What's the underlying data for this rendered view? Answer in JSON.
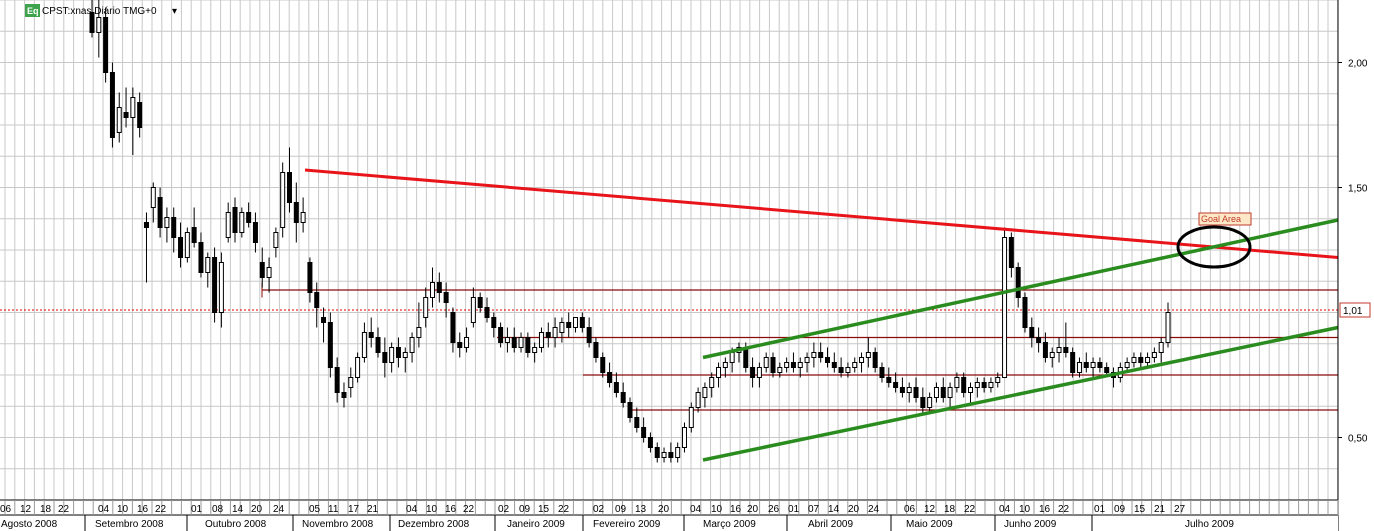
{
  "header": {
    "badge": "Eq",
    "title": "CPST:xnas Diário TMG+0",
    "menu_arrow": "▾"
  },
  "chart_data": {
    "type": "candlestick",
    "symbol": "CPST:xnas",
    "period": "Diário",
    "ylim": [
      0.25,
      2.25
    ],
    "yticks": [
      "2,00",
      "1,50",
      "1,01",
      "0,50"
    ],
    "ytick_values": [
      2.0,
      1.5,
      1.01,
      0.5
    ],
    "last_price_label": "1,01",
    "last_price": 1.01,
    "x_day_labels": [
      "06",
      "12",
      "18",
      "22",
      "04",
      "10",
      "16",
      "22",
      "01",
      "08",
      "14",
      "20",
      "24",
      "05",
      "11",
      "17",
      "21",
      "04",
      "10",
      "16",
      "22",
      "02",
      "09",
      "15",
      "22",
      "02",
      "09",
      "13",
      "20",
      "04",
      "10",
      "16",
      "20",
      "26",
      "01",
      "07",
      "14",
      "20",
      "24",
      "06",
      "12",
      "18",
      "22",
      "04",
      "10",
      "16",
      "22",
      "01",
      "09",
      "15",
      "21",
      "27"
    ],
    "x_months": [
      "Agosto 2008",
      "Setembro 2008",
      "Outubro 2008",
      "Novembro 2008",
      "Dezembro 2008",
      "Janeiro 2009",
      "Fevereiro 2009",
      "Março 2009",
      "Abril 2009",
      "Maio 2009",
      "Junho 2009",
      "Julho 2009"
    ],
    "annotation": "Goal Area",
    "colors": {
      "resistance": "#e8141a",
      "channel": "#2a8c1e",
      "level_lines": "#8b0a0a",
      "last_price": "#e00000",
      "candle": "#000000",
      "grid": "#c8c8c8",
      "badge": "#3fa34d"
    },
    "candles": [
      {
        "o": 2.2,
        "h": 2.3,
        "l": 2.1,
        "c": 2.12
      },
      {
        "o": 2.12,
        "h": 2.25,
        "l": 2.02,
        "c": 2.18
      },
      {
        "o": 2.18,
        "h": 2.22,
        "l": 1.92,
        "c": 1.96
      },
      {
        "o": 1.96,
        "h": 2.0,
        "l": 1.66,
        "c": 1.7
      },
      {
        "o": 1.72,
        "h": 1.88,
        "l": 1.68,
        "c": 1.82
      },
      {
        "o": 1.8,
        "h": 1.9,
        "l": 1.74,
        "c": 1.78
      },
      {
        "o": 1.78,
        "h": 1.9,
        "l": 1.63,
        "c": 1.86
      },
      {
        "o": 1.84,
        "h": 1.88,
        "l": 1.7,
        "c": 1.74
      },
      {
        "o": 1.36,
        "h": 1.4,
        "l": 1.12,
        "c": 1.34
      },
      {
        "o": 1.42,
        "h": 1.52,
        "l": 1.36,
        "c": 1.5
      },
      {
        "o": 1.46,
        "h": 1.5,
        "l": 1.3,
        "c": 1.34
      },
      {
        "o": 1.34,
        "h": 1.42,
        "l": 1.28,
        "c": 1.38
      },
      {
        "o": 1.38,
        "h": 1.42,
        "l": 1.24,
        "c": 1.3
      },
      {
        "o": 1.3,
        "h": 1.36,
        "l": 1.18,
        "c": 1.22
      },
      {
        "o": 1.22,
        "h": 1.34,
        "l": 1.2,
        "c": 1.32
      },
      {
        "o": 1.34,
        "h": 1.42,
        "l": 1.26,
        "c": 1.28
      },
      {
        "o": 1.28,
        "h": 1.32,
        "l": 1.14,
        "c": 1.16
      },
      {
        "o": 1.16,
        "h": 1.24,
        "l": 1.1,
        "c": 1.22
      },
      {
        "o": 1.22,
        "h": 1.26,
        "l": 0.96,
        "c": 1.0
      },
      {
        "o": 1.0,
        "h": 1.24,
        "l": 0.94,
        "c": 1.2
      },
      {
        "o": 1.3,
        "h": 1.44,
        "l": 1.28,
        "c": 1.4
      },
      {
        "o": 1.42,
        "h": 1.46,
        "l": 1.28,
        "c": 1.32
      },
      {
        "o": 1.32,
        "h": 1.42,
        "l": 1.3,
        "c": 1.4
      },
      {
        "o": 1.4,
        "h": 1.44,
        "l": 1.34,
        "c": 1.36
      },
      {
        "o": 1.36,
        "h": 1.4,
        "l": 1.24,
        "c": 1.28
      },
      {
        "o": 1.2,
        "h": 1.26,
        "l": 1.1,
        "c": 1.14
      },
      {
        "o": 1.14,
        "h": 1.22,
        "l": 1.08,
        "c": 1.18
      },
      {
        "o": 1.26,
        "h": 1.34,
        "l": 1.22,
        "c": 1.32
      },
      {
        "o": 1.34,
        "h": 1.6,
        "l": 1.3,
        "c": 1.56
      },
      {
        "o": 1.56,
        "h": 1.66,
        "l": 1.4,
        "c": 1.44
      },
      {
        "o": 1.44,
        "h": 1.52,
        "l": 1.28,
        "c": 1.36
      },
      {
        "o": 1.36,
        "h": 1.46,
        "l": 1.32,
        "c": 1.4
      },
      {
        "o": 1.2,
        "h": 1.22,
        "l": 1.04,
        "c": 1.08
      },
      {
        "o": 1.08,
        "h": 1.12,
        "l": 0.94,
        "c": 1.02
      },
      {
        "o": 0.98,
        "h": 1.02,
        "l": 0.88,
        "c": 0.96
      },
      {
        "o": 0.96,
        "h": 1.0,
        "l": 0.74,
        "c": 0.78
      },
      {
        "o": 0.78,
        "h": 0.82,
        "l": 0.64,
        "c": 0.68
      },
      {
        "o": 0.68,
        "h": 0.72,
        "l": 0.62,
        "c": 0.66
      },
      {
        "o": 0.7,
        "h": 0.78,
        "l": 0.66,
        "c": 0.74
      },
      {
        "o": 0.74,
        "h": 0.84,
        "l": 0.72,
        "c": 0.82
      },
      {
        "o": 0.82,
        "h": 0.96,
        "l": 0.8,
        "c": 0.92
      },
      {
        "o": 0.92,
        "h": 0.98,
        "l": 0.86,
        "c": 0.9
      },
      {
        "o": 0.9,
        "h": 0.94,
        "l": 0.82,
        "c": 0.84
      },
      {
        "o": 0.84,
        "h": 0.9,
        "l": 0.74,
        "c": 0.8
      },
      {
        "o": 0.8,
        "h": 0.88,
        "l": 0.76,
        "c": 0.86
      },
      {
        "o": 0.86,
        "h": 0.9,
        "l": 0.78,
        "c": 0.82
      },
      {
        "o": 0.82,
        "h": 0.86,
        "l": 0.76,
        "c": 0.84
      },
      {
        "o": 0.84,
        "h": 0.92,
        "l": 0.8,
        "c": 0.9
      },
      {
        "o": 0.9,
        "h": 1.04,
        "l": 0.86,
        "c": 0.94
      },
      {
        "o": 0.98,
        "h": 1.1,
        "l": 0.94,
        "c": 1.06
      },
      {
        "o": 1.06,
        "h": 1.18,
        "l": 1.02,
        "c": 1.12
      },
      {
        "o": 1.12,
        "h": 1.16,
        "l": 1.04,
        "c": 1.08
      },
      {
        "o": 1.08,
        "h": 1.12,
        "l": 0.98,
        "c": 1.04
      },
      {
        "o": 1.0,
        "h": 1.02,
        "l": 0.84,
        "c": 0.88
      },
      {
        "o": 0.88,
        "h": 0.92,
        "l": 0.82,
        "c": 0.86
      },
      {
        "o": 0.86,
        "h": 0.94,
        "l": 0.84,
        "c": 0.9
      },
      {
        "o": 0.96,
        "h": 1.1,
        "l": 0.94,
        "c": 1.06
      },
      {
        "o": 1.06,
        "h": 1.08,
        "l": 1.0,
        "c": 1.02
      },
      {
        "o": 1.02,
        "h": 1.06,
        "l": 0.96,
        "c": 0.98
      },
      {
        "o": 0.98,
        "h": 1.0,
        "l": 0.9,
        "c": 0.94
      },
      {
        "o": 0.94,
        "h": 0.96,
        "l": 0.86,
        "c": 0.88
      },
      {
        "o": 0.88,
        "h": 0.94,
        "l": 0.84,
        "c": 0.9
      },
      {
        "o": 0.9,
        "h": 0.94,
        "l": 0.84,
        "c": 0.86
      },
      {
        "o": 0.86,
        "h": 0.92,
        "l": 0.84,
        "c": 0.9
      },
      {
        "o": 0.9,
        "h": 0.92,
        "l": 0.82,
        "c": 0.84
      },
      {
        "o": 0.84,
        "h": 0.88,
        "l": 0.8,
        "c": 0.86
      },
      {
        "o": 0.86,
        "h": 0.94,
        "l": 0.84,
        "c": 0.92
      },
      {
        "o": 0.92,
        "h": 0.96,
        "l": 0.86,
        "c": 0.9
      },
      {
        "o": 0.9,
        "h": 0.98,
        "l": 0.86,
        "c": 0.94
      },
      {
        "o": 0.92,
        "h": 0.98,
        "l": 0.88,
        "c": 0.96
      },
      {
        "o": 0.96,
        "h": 1.0,
        "l": 0.9,
        "c": 0.94
      },
      {
        "o": 0.94,
        "h": 0.98,
        "l": 0.92,
        "c": 0.98
      },
      {
        "o": 0.98,
        "h": 1.0,
        "l": 0.92,
        "c": 0.94
      },
      {
        "o": 0.94,
        "h": 0.98,
        "l": 0.86,
        "c": 0.88
      },
      {
        "o": 0.88,
        "h": 0.9,
        "l": 0.8,
        "c": 0.82
      },
      {
        "o": 0.82,
        "h": 0.84,
        "l": 0.74,
        "c": 0.76
      },
      {
        "o": 0.76,
        "h": 0.8,
        "l": 0.7,
        "c": 0.72
      },
      {
        "o": 0.72,
        "h": 0.76,
        "l": 0.66,
        "c": 0.68
      },
      {
        "o": 0.68,
        "h": 0.72,
        "l": 0.62,
        "c": 0.64
      },
      {
        "o": 0.64,
        "h": 0.66,
        "l": 0.56,
        "c": 0.58
      },
      {
        "o": 0.58,
        "h": 0.62,
        "l": 0.52,
        "c": 0.54
      },
      {
        "o": 0.54,
        "h": 0.58,
        "l": 0.48,
        "c": 0.5
      },
      {
        "o": 0.5,
        "h": 0.52,
        "l": 0.44,
        "c": 0.46
      },
      {
        "o": 0.46,
        "h": 0.48,
        "l": 0.4,
        "c": 0.42
      },
      {
        "o": 0.42,
        "h": 0.46,
        "l": 0.4,
        "c": 0.44
      },
      {
        "o": 0.44,
        "h": 0.48,
        "l": 0.4,
        "c": 0.42
      },
      {
        "o": 0.42,
        "h": 0.48,
        "l": 0.4,
        "c": 0.46
      },
      {
        "o": 0.46,
        "h": 0.56,
        "l": 0.44,
        "c": 0.54
      },
      {
        "o": 0.54,
        "h": 0.64,
        "l": 0.52,
        "c": 0.62
      },
      {
        "o": 0.62,
        "h": 0.7,
        "l": 0.6,
        "c": 0.68
      },
      {
        "o": 0.66,
        "h": 0.72,
        "l": 0.62,
        "c": 0.7
      },
      {
        "o": 0.7,
        "h": 0.76,
        "l": 0.66,
        "c": 0.74
      },
      {
        "o": 0.74,
        "h": 0.8,
        "l": 0.7,
        "c": 0.78
      },
      {
        "o": 0.78,
        "h": 0.82,
        "l": 0.74,
        "c": 0.8
      },
      {
        "o": 0.8,
        "h": 0.86,
        "l": 0.76,
        "c": 0.84
      },
      {
        "o": 0.84,
        "h": 0.88,
        "l": 0.8,
        "c": 0.86
      },
      {
        "o": 0.86,
        "h": 0.88,
        "l": 0.76,
        "c": 0.78
      },
      {
        "o": 0.78,
        "h": 0.82,
        "l": 0.7,
        "c": 0.74
      },
      {
        "o": 0.74,
        "h": 0.8,
        "l": 0.7,
        "c": 0.78
      },
      {
        "o": 0.78,
        "h": 0.84,
        "l": 0.76,
        "c": 0.82
      },
      {
        "o": 0.82,
        "h": 0.84,
        "l": 0.74,
        "c": 0.76
      },
      {
        "o": 0.76,
        "h": 0.8,
        "l": 0.74,
        "c": 0.78
      },
      {
        "o": 0.78,
        "h": 0.82,
        "l": 0.76,
        "c": 0.8
      },
      {
        "o": 0.8,
        "h": 0.84,
        "l": 0.76,
        "c": 0.78
      },
      {
        "o": 0.78,
        "h": 0.82,
        "l": 0.74,
        "c": 0.8
      },
      {
        "o": 0.8,
        "h": 0.84,
        "l": 0.76,
        "c": 0.82
      },
      {
        "o": 0.82,
        "h": 0.88,
        "l": 0.78,
        "c": 0.84
      },
      {
        "o": 0.84,
        "h": 0.88,
        "l": 0.8,
        "c": 0.82
      },
      {
        "o": 0.82,
        "h": 0.86,
        "l": 0.78,
        "c": 0.8
      },
      {
        "o": 0.8,
        "h": 0.84,
        "l": 0.76,
        "c": 0.78
      },
      {
        "o": 0.78,
        "h": 0.82,
        "l": 0.74,
        "c": 0.76
      },
      {
        "o": 0.76,
        "h": 0.8,
        "l": 0.74,
        "c": 0.78
      },
      {
        "o": 0.78,
        "h": 0.82,
        "l": 0.76,
        "c": 0.8
      },
      {
        "o": 0.8,
        "h": 0.84,
        "l": 0.76,
        "c": 0.82
      },
      {
        "o": 0.82,
        "h": 0.9,
        "l": 0.78,
        "c": 0.84
      },
      {
        "o": 0.84,
        "h": 0.86,
        "l": 0.76,
        "c": 0.78
      },
      {
        "o": 0.78,
        "h": 0.8,
        "l": 0.72,
        "c": 0.74
      },
      {
        "o": 0.74,
        "h": 0.78,
        "l": 0.7,
        "c": 0.72
      },
      {
        "o": 0.72,
        "h": 0.76,
        "l": 0.68,
        "c": 0.7
      },
      {
        "o": 0.7,
        "h": 0.74,
        "l": 0.66,
        "c": 0.68
      },
      {
        "o": 0.68,
        "h": 0.72,
        "l": 0.64,
        "c": 0.7
      },
      {
        "o": 0.7,
        "h": 0.74,
        "l": 0.64,
        "c": 0.66
      },
      {
        "o": 0.66,
        "h": 0.7,
        "l": 0.6,
        "c": 0.62
      },
      {
        "o": 0.62,
        "h": 0.68,
        "l": 0.6,
        "c": 0.66
      },
      {
        "o": 0.66,
        "h": 0.72,
        "l": 0.64,
        "c": 0.7
      },
      {
        "o": 0.7,
        "h": 0.74,
        "l": 0.64,
        "c": 0.66
      },
      {
        "o": 0.66,
        "h": 0.72,
        "l": 0.62,
        "c": 0.7
      },
      {
        "o": 0.7,
        "h": 0.76,
        "l": 0.68,
        "c": 0.74
      },
      {
        "o": 0.74,
        "h": 0.76,
        "l": 0.66,
        "c": 0.68
      },
      {
        "o": 0.68,
        "h": 0.72,
        "l": 0.64,
        "c": 0.7
      },
      {
        "o": 0.7,
        "h": 0.74,
        "l": 0.66,
        "c": 0.72
      },
      {
        "o": 0.72,
        "h": 0.74,
        "l": 0.68,
        "c": 0.7
      },
      {
        "o": 0.7,
        "h": 0.74,
        "l": 0.68,
        "c": 0.72
      },
      {
        "o": 0.72,
        "h": 0.76,
        "l": 0.7,
        "c": 0.74
      },
      {
        "o": 0.74,
        "h": 1.34,
        "l": 0.86,
        "c": 1.3
      },
      {
        "o": 1.3,
        "h": 1.32,
        "l": 1.14,
        "c": 1.18
      },
      {
        "o": 1.18,
        "h": 1.2,
        "l": 1.02,
        "c": 1.06
      },
      {
        "o": 1.06,
        "h": 1.08,
        "l": 0.92,
        "c": 0.94
      },
      {
        "o": 0.94,
        "h": 0.98,
        "l": 0.86,
        "c": 0.9
      },
      {
        "o": 0.9,
        "h": 0.94,
        "l": 0.84,
        "c": 0.88
      },
      {
        "o": 0.88,
        "h": 0.92,
        "l": 0.8,
        "c": 0.82
      },
      {
        "o": 0.82,
        "h": 0.86,
        "l": 0.78,
        "c": 0.84
      },
      {
        "o": 0.84,
        "h": 0.9,
        "l": 0.8,
        "c": 0.86
      },
      {
        "o": 0.86,
        "h": 0.96,
        "l": 0.82,
        "c": 0.84
      },
      {
        "o": 0.84,
        "h": 0.86,
        "l": 0.74,
        "c": 0.76
      },
      {
        "o": 0.76,
        "h": 0.82,
        "l": 0.74,
        "c": 0.8
      },
      {
        "o": 0.8,
        "h": 0.84,
        "l": 0.76,
        "c": 0.78
      },
      {
        "o": 0.78,
        "h": 0.82,
        "l": 0.74,
        "c": 0.8
      },
      {
        "o": 0.8,
        "h": 0.82,
        "l": 0.76,
        "c": 0.78
      },
      {
        "o": 0.78,
        "h": 0.8,
        "l": 0.74,
        "c": 0.76
      },
      {
        "o": 0.76,
        "h": 0.78,
        "l": 0.7,
        "c": 0.74
      },
      {
        "o": 0.74,
        "h": 0.8,
        "l": 0.72,
        "c": 0.78
      },
      {
        "o": 0.78,
        "h": 0.82,
        "l": 0.76,
        "c": 0.8
      },
      {
        "o": 0.8,
        "h": 0.84,
        "l": 0.78,
        "c": 0.82
      },
      {
        "o": 0.82,
        "h": 0.84,
        "l": 0.78,
        "c": 0.8
      },
      {
        "o": 0.8,
        "h": 0.84,
        "l": 0.78,
        "c": 0.82
      },
      {
        "o": 0.82,
        "h": 0.86,
        "l": 0.8,
        "c": 0.84
      },
      {
        "o": 0.84,
        "h": 0.9,
        "l": 0.8,
        "c": 0.88
      },
      {
        "o": 0.88,
        "h": 1.04,
        "l": 0.86,
        "c": 1.0
      }
    ]
  }
}
